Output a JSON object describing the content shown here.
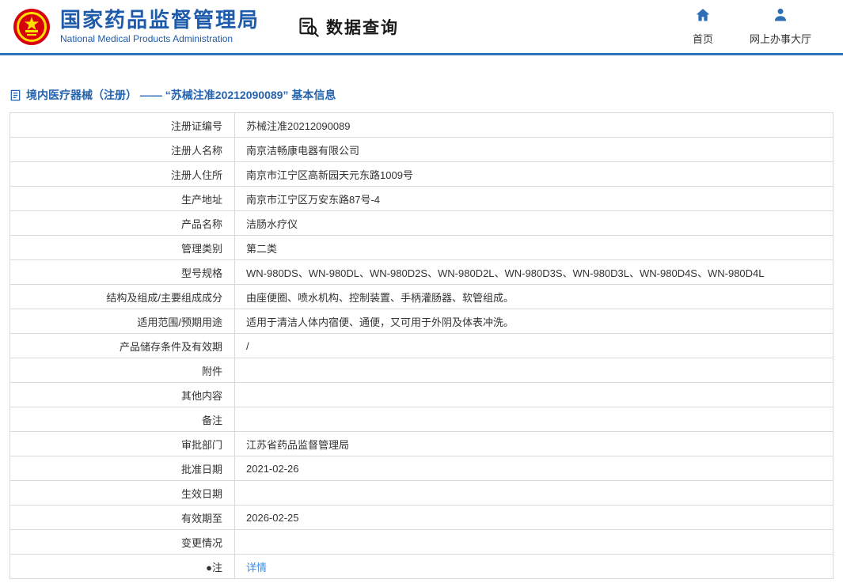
{
  "theme": {
    "brand_blue": "#1e5cab",
    "divider_blue": "#2e72b8",
    "link_blue": "#3a8ee6",
    "emblem_red": "#d7000f",
    "emblem_yellow": "#ffde00"
  },
  "header": {
    "logo_icon": "national-emblem-icon",
    "org_name_cn": "国家药品监督管理局",
    "org_name_en": "National Medical Products Administration",
    "data_query": {
      "icon": "data-query-icon",
      "label": "数据查询"
    },
    "nav": [
      {
        "icon": "home-icon",
        "label": "首页"
      },
      {
        "icon": "person-icon",
        "label": "网上办事大厅"
      }
    ]
  },
  "breadcrumb": {
    "icon": "document-icon",
    "text": "境内医疗器械（注册） —— “苏械注准20212090089” 基本信息"
  },
  "table": {
    "rows": [
      {
        "label": "注册证编号",
        "value": "苏械注准20212090089"
      },
      {
        "label": "注册人名称",
        "value": "南京洁畅康电器有限公司"
      },
      {
        "label": "注册人住所",
        "value": "南京市江宁区高新园天元东路1009号"
      },
      {
        "label": "生产地址",
        "value": "南京市江宁区万安东路87号-4"
      },
      {
        "label": "产品名称",
        "value": "洁肠水疗仪"
      },
      {
        "label": "管理类别",
        "value": "第二类"
      },
      {
        "label": "型号规格",
        "value": "WN-980DS、WN-980DL、WN-980D2S、WN-980D2L、WN-980D3S、WN-980D3L、WN-980D4S、WN-980D4L"
      },
      {
        "label": "结构及组成/主要组成成分",
        "value": "由座便圈、喷水机构、控制装置、手柄灌肠器、软管组成。"
      },
      {
        "label": "适用范围/预期用途",
        "value": "适用于清洁人体内宿便、通便，又可用于外阴及体表冲洗。"
      },
      {
        "label": "产品储存条件及有效期",
        "value": "/"
      },
      {
        "label": "附件",
        "value": ""
      },
      {
        "label": "其他内容",
        "value": ""
      },
      {
        "label": "备注",
        "value": ""
      },
      {
        "label": "审批部门",
        "value": "江苏省药品监督管理局"
      },
      {
        "label": "批准日期",
        "value": "2021-02-26"
      },
      {
        "label": "生效日期",
        "value": ""
      },
      {
        "label": "有效期至",
        "value": "2026-02-25"
      },
      {
        "label": "变更情况",
        "value": ""
      },
      {
        "label": "●注",
        "value": "详情"
      }
    ]
  }
}
